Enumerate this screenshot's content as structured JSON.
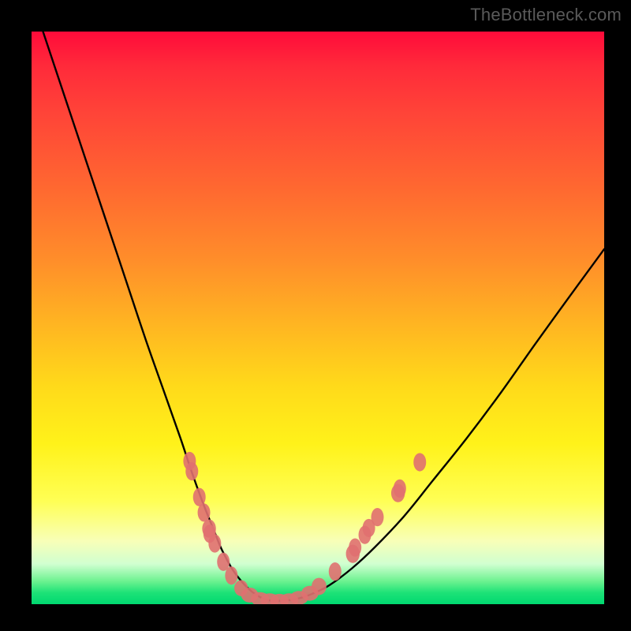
{
  "watermark": "TheBottleneck.com",
  "chart_data": {
    "type": "line",
    "title": "",
    "xlabel": "",
    "ylabel": "",
    "xlim": [
      0,
      100
    ],
    "ylim": [
      0,
      100
    ],
    "series": [
      {
        "name": "bottleneck-curve",
        "x": [
          2,
          5,
          8,
          11,
          14,
          17,
          20,
          23,
          26,
          28,
          30,
          32,
          33,
          34,
          35,
          36,
          37,
          38,
          39,
          40,
          41,
          42,
          43,
          45,
          47,
          49,
          52,
          56,
          60,
          65,
          70,
          76,
          82,
          88,
          94,
          100
        ],
        "y": [
          100,
          91,
          82,
          73,
          64,
          55,
          46,
          37.5,
          29,
          23,
          17.5,
          12.5,
          10,
          8,
          6.2,
          4.8,
          3.6,
          2.6,
          1.8,
          1.2,
          0.8,
          0.6,
          0.6,
          0.7,
          1.1,
          1.8,
          3.3,
          6.3,
          10,
          15.3,
          21.5,
          29,
          37,
          45.5,
          53.8,
          62
        ]
      }
    ],
    "markers": {
      "name": "highlight-nodes",
      "color": "#e07070",
      "points": [
        {
          "x": 27.6,
          "y": 25.0,
          "rx": 1.1,
          "ry": 1.6
        },
        {
          "x": 28.0,
          "y": 23.2,
          "rx": 1.1,
          "ry": 1.6
        },
        {
          "x": 29.3,
          "y": 18.7,
          "rx": 1.1,
          "ry": 1.6
        },
        {
          "x": 30.1,
          "y": 16.0,
          "rx": 1.1,
          "ry": 1.6
        },
        {
          "x": 31.0,
          "y": 13.2,
          "rx": 1.2,
          "ry": 1.6
        },
        {
          "x": 31.1,
          "y": 12.3,
          "rx": 1.1,
          "ry": 1.6
        },
        {
          "x": 32.0,
          "y": 10.6,
          "rx": 1.1,
          "ry": 1.6
        },
        {
          "x": 33.5,
          "y": 7.4,
          "rx": 1.1,
          "ry": 1.6
        },
        {
          "x": 34.9,
          "y": 5.0,
          "rx": 1.1,
          "ry": 1.6
        },
        {
          "x": 36.6,
          "y": 2.8,
          "rx": 1.2,
          "ry": 1.4
        },
        {
          "x": 38.1,
          "y": 1.6,
          "rx": 1.5,
          "ry": 1.3
        },
        {
          "x": 39.9,
          "y": 0.9,
          "rx": 1.6,
          "ry": 1.2
        },
        {
          "x": 41.6,
          "y": 0.7,
          "rx": 1.6,
          "ry": 1.2
        },
        {
          "x": 43.3,
          "y": 0.6,
          "rx": 1.6,
          "ry": 1.2
        },
        {
          "x": 45.0,
          "y": 0.7,
          "rx": 1.6,
          "ry": 1.2
        },
        {
          "x": 46.7,
          "y": 1.1,
          "rx": 1.6,
          "ry": 1.2
        },
        {
          "x": 48.6,
          "y": 1.9,
          "rx": 1.5,
          "ry": 1.3
        },
        {
          "x": 50.2,
          "y": 3.1,
          "rx": 1.3,
          "ry": 1.5
        },
        {
          "x": 53.0,
          "y": 5.7,
          "rx": 1.1,
          "ry": 1.6
        },
        {
          "x": 56.1,
          "y": 8.8,
          "rx": 1.2,
          "ry": 1.6
        },
        {
          "x": 56.5,
          "y": 9.9,
          "rx": 1.1,
          "ry": 1.6
        },
        {
          "x": 58.2,
          "y": 12.1,
          "rx": 1.1,
          "ry": 1.6
        },
        {
          "x": 58.9,
          "y": 13.3,
          "rx": 1.1,
          "ry": 1.6
        },
        {
          "x": 60.4,
          "y": 15.2,
          "rx": 1.1,
          "ry": 1.6
        },
        {
          "x": 64.0,
          "y": 19.4,
          "rx": 1.2,
          "ry": 1.6
        },
        {
          "x": 64.3,
          "y": 20.2,
          "rx": 1.1,
          "ry": 1.6
        },
        {
          "x": 67.8,
          "y": 24.8,
          "rx": 1.1,
          "ry": 1.6
        }
      ]
    }
  }
}
